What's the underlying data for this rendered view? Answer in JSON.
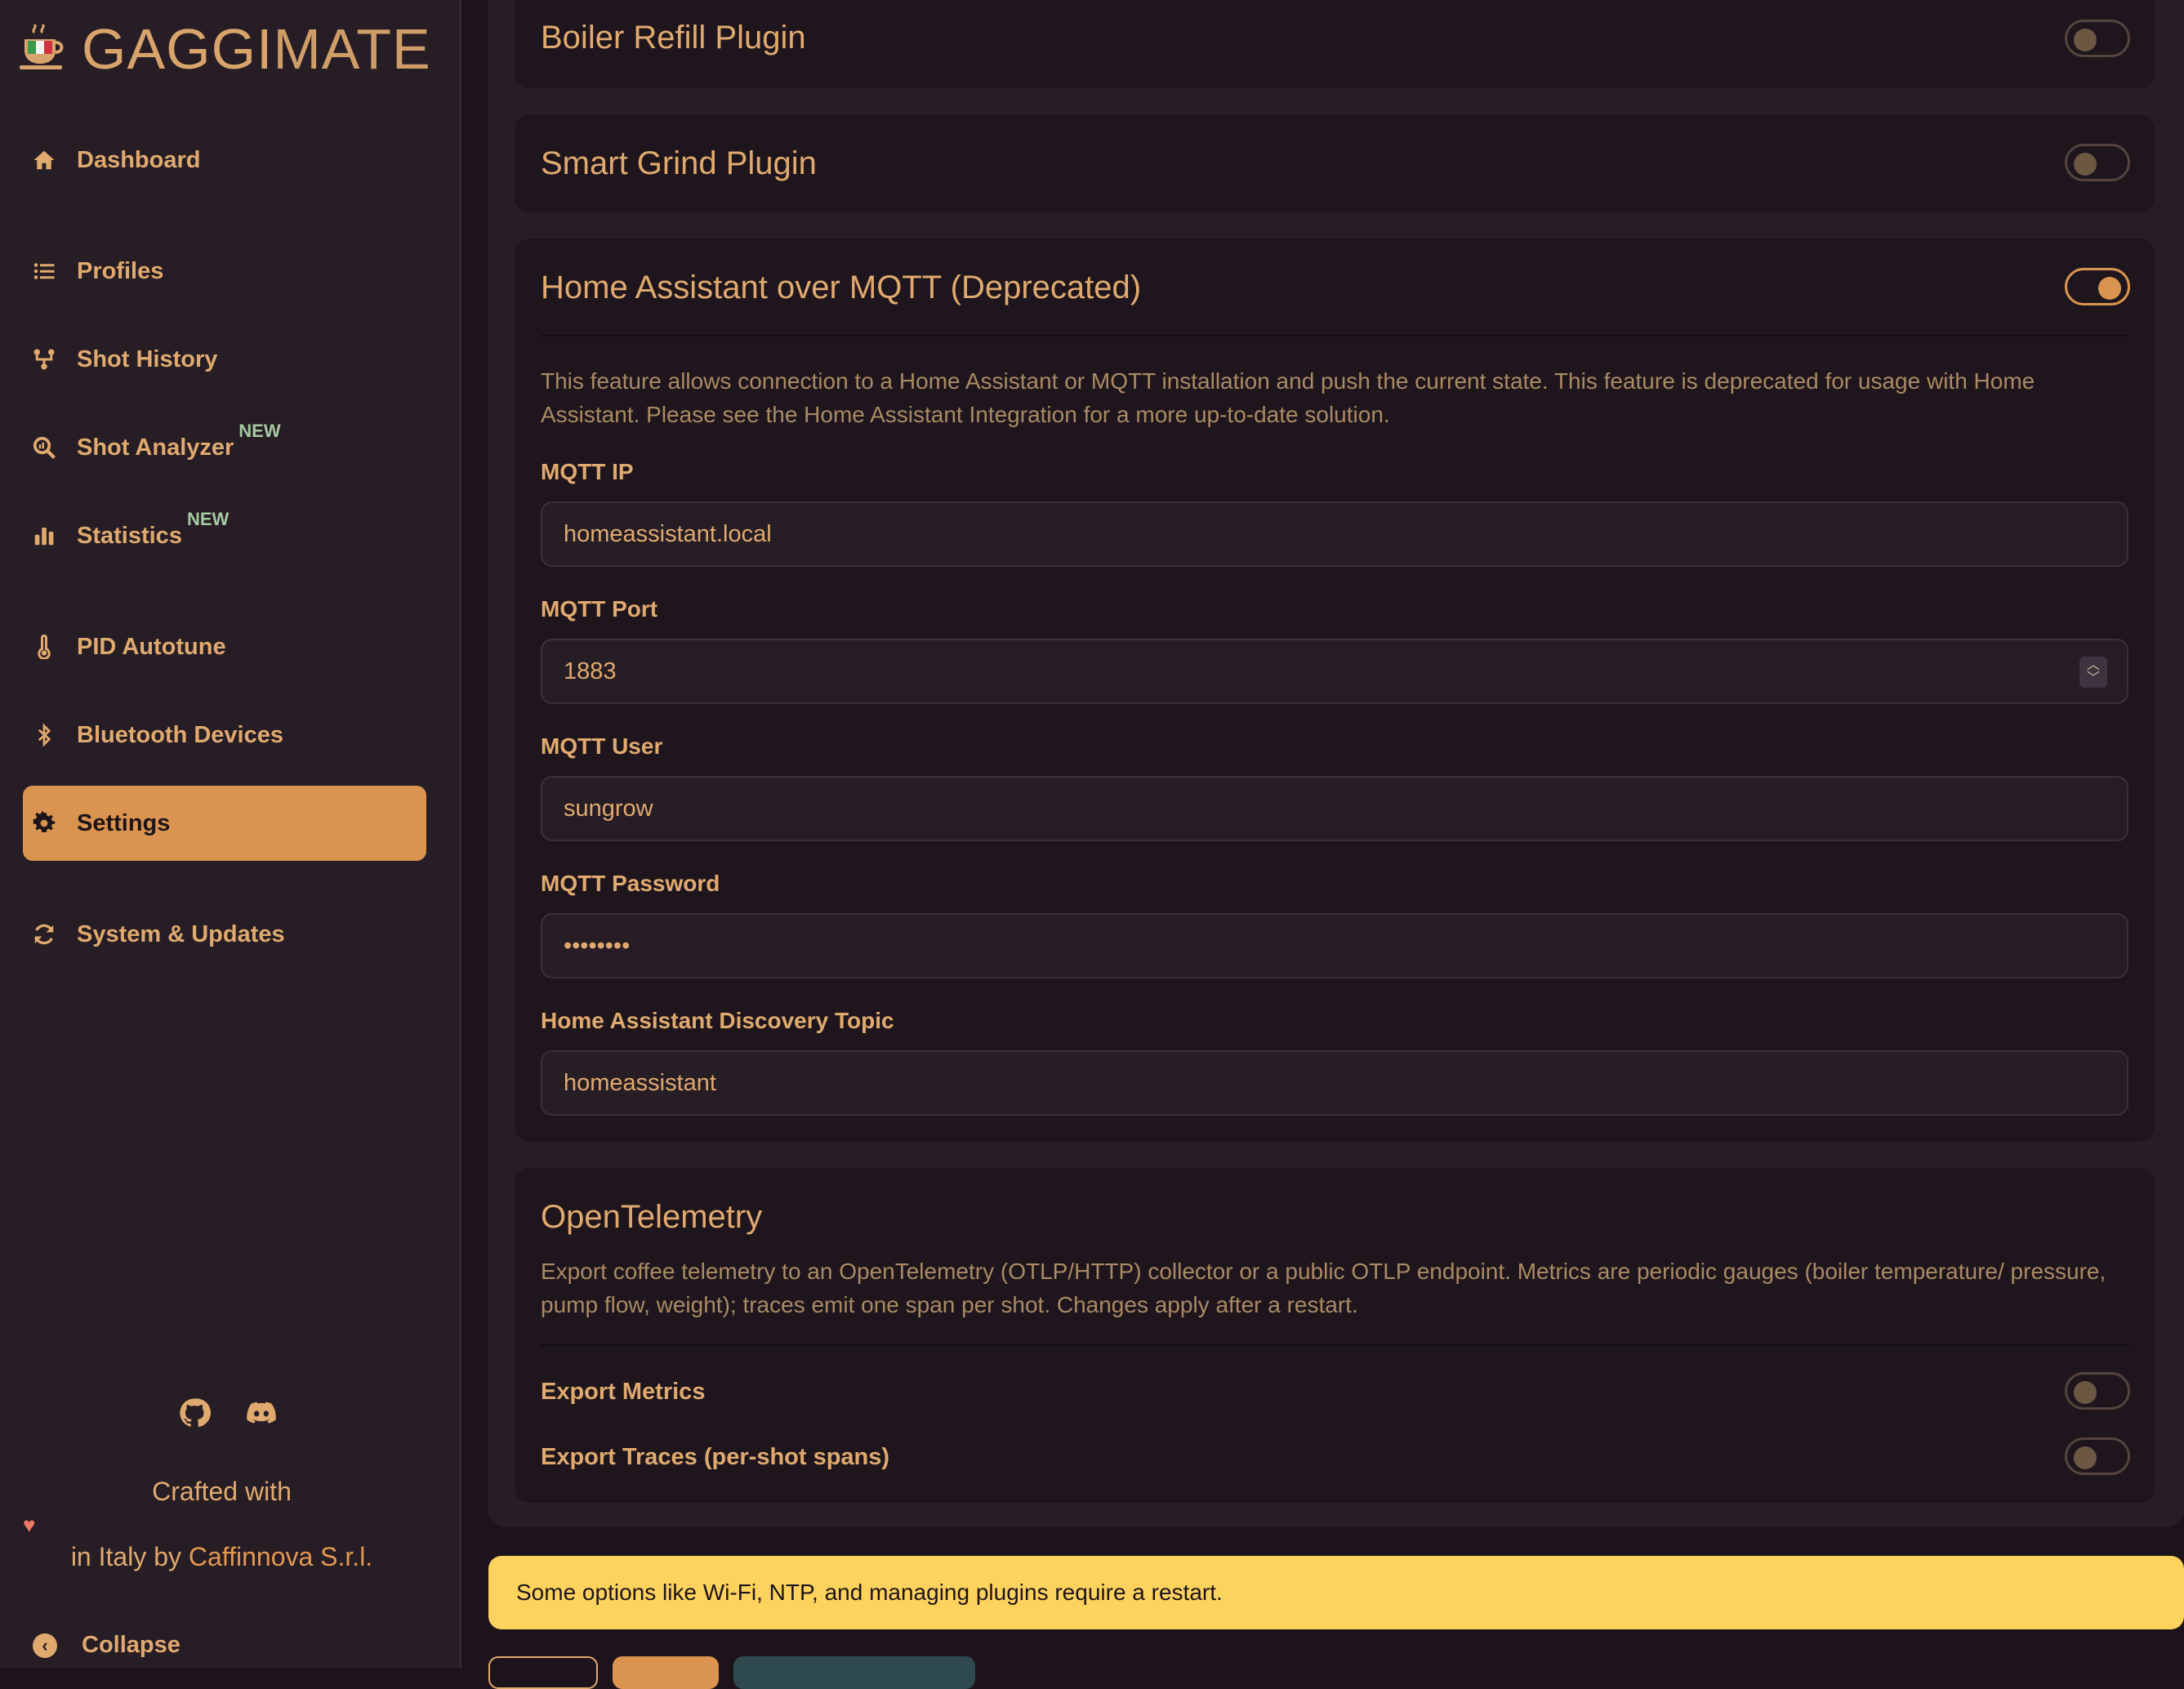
{
  "brand": {
    "bold": "GAGGI",
    "light": "MATE"
  },
  "nav": [
    {
      "label": "Dashboard",
      "icon": "home-icon"
    },
    {
      "label": "Profiles",
      "icon": "list-icon"
    },
    {
      "label": "Shot History",
      "icon": "history-icon"
    },
    {
      "label": "Shot Analyzer",
      "icon": "analyzer-icon",
      "badge": "NEW"
    },
    {
      "label": "Statistics",
      "icon": "bar-chart-icon",
      "badge": "NEW"
    },
    {
      "label": "PID Autotune",
      "icon": "thermometer-icon"
    },
    {
      "label": "Bluetooth Devices",
      "icon": "bluetooth-icon"
    },
    {
      "label": "Settings",
      "icon": "gear-icon",
      "active": true
    },
    {
      "label": "System & Updates",
      "icon": "refresh-icon"
    }
  ],
  "footer": {
    "crafted_line1": "Crafted with",
    "crafted_line2_prefix": "in Italy by ",
    "company": "Caffinnova S.r.l.",
    "collapse": "Collapse"
  },
  "plugins": {
    "boiler_refill": {
      "title": "Boiler Refill Plugin",
      "enabled": false
    },
    "smart_grind": {
      "title": "Smart Grind Plugin",
      "enabled": false
    },
    "home_assistant": {
      "title": "Home Assistant over MQTT (Deprecated)",
      "enabled": true,
      "description": "This feature allows connection to a Home Assistant or MQTT installation and push the current state. This feature is deprecated for usage with Home Assistant. Please see the Home Assistant Integration for a more up-to-date solution.",
      "fields": {
        "ip_label": "MQTT IP",
        "ip_value": "homeassistant.local",
        "port_label": "MQTT Port",
        "port_value": "1883",
        "user_label": "MQTT User",
        "user_value": "sungrow",
        "password_label": "MQTT Password",
        "password_value": "••••••••",
        "topic_label": "Home Assistant Discovery Topic",
        "topic_value": "homeassistant"
      }
    },
    "opentelemetry": {
      "title": "OpenTelemetry",
      "description": "Export coffee telemetry to an OpenTelemetry (OTLP/HTTP) collector or a public OTLP endpoint. Metrics are periodic gauges (boiler temperature/ pressure, pump flow, weight); traces emit one span per shot. Changes apply after a restart.",
      "export_metrics": {
        "label": "Export Metrics",
        "enabled": false
      },
      "export_traces": {
        "label": "Export Traces (per-shot spans)",
        "enabled": false
      }
    }
  },
  "notice": "Some options like Wi-Fi, NTP, and managing plugins require a restart.",
  "colors": {
    "accent": "#da944f",
    "background": "#1d141b",
    "sidebar": "#271d25",
    "notice": "#fdd25d",
    "badge": "#a6c9a2"
  }
}
